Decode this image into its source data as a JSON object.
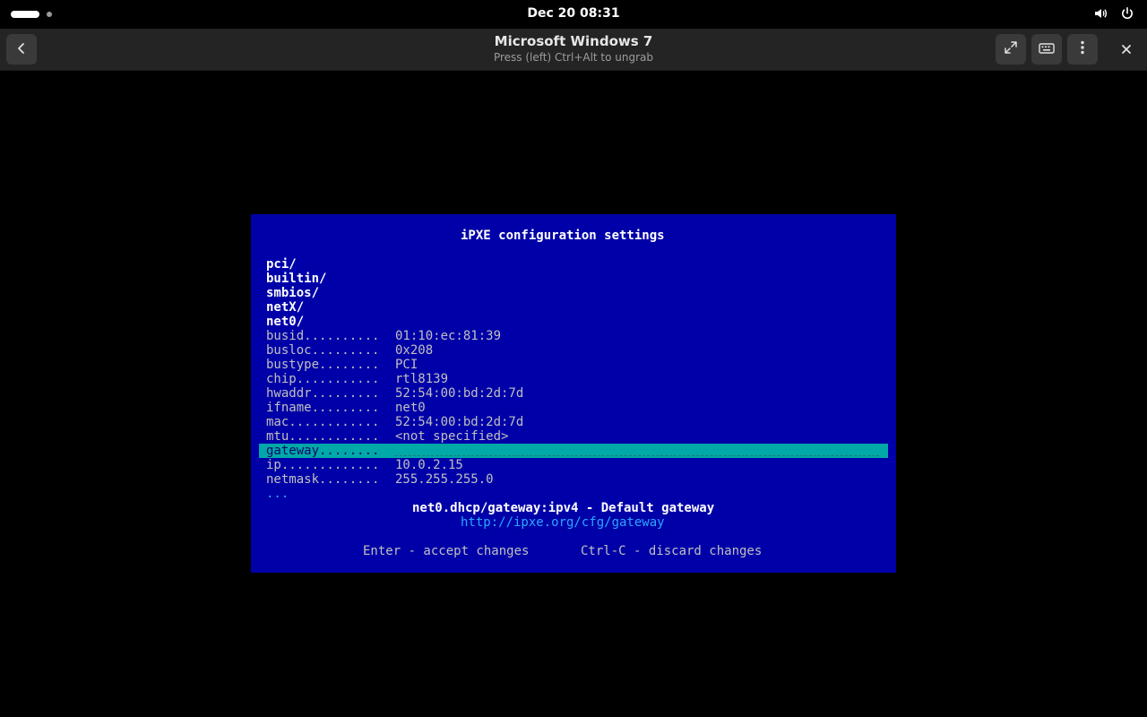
{
  "topbar": {
    "clock": "Dec 20  08:31",
    "icons": [
      "activities-indicator",
      "volume-icon",
      "power-icon"
    ]
  },
  "headerbar": {
    "title": "Microsoft Windows 7",
    "subtitle": "Press (left) Ctrl+Alt to ungrab",
    "icons": [
      "back-icon",
      "fullscreen-icon",
      "keyboard-icon",
      "menu-icon",
      "close-icon"
    ]
  },
  "ipxe": {
    "title": "iPXE configuration settings",
    "dirs": [
      "pci/",
      "builtin/",
      "smbios/",
      "netX/",
      "net0/"
    ],
    "settings": [
      {
        "key": "busid..........",
        "value": "01:10:ec:81:39"
      },
      {
        "key": "busloc.........",
        "value": "0x208"
      },
      {
        "key": "bustype........",
        "value": "PCI"
      },
      {
        "key": "chip...........",
        "value": "rtl8139"
      },
      {
        "key": "hwaddr.........",
        "value": "52:54:00:bd:2d:7d"
      },
      {
        "key": "ifname.........",
        "value": "net0"
      },
      {
        "key": "mac............",
        "value": "52:54:00:bd:2d:7d"
      },
      {
        "key": "mtu............",
        "value": "<not specified>"
      }
    ],
    "selected": {
      "key": "gateway........",
      "value": ""
    },
    "settings_after": [
      {
        "key": "ip.............",
        "value": "10.0.2.15"
      },
      {
        "key": "netmask........",
        "value": "255.255.255.0"
      }
    ],
    "more": "...",
    "description": "net0.dhcp/gateway:ipv4 - Default gateway",
    "url": "http://ipxe.org/cfg/gateway",
    "hint_enter": "Enter - accept changes",
    "hint_ctrlc": "Ctrl-C - discard changes"
  },
  "colors": {
    "vm_background": "#0000a8",
    "selection": "#00a8a8",
    "link": "#2aa7ff"
  }
}
